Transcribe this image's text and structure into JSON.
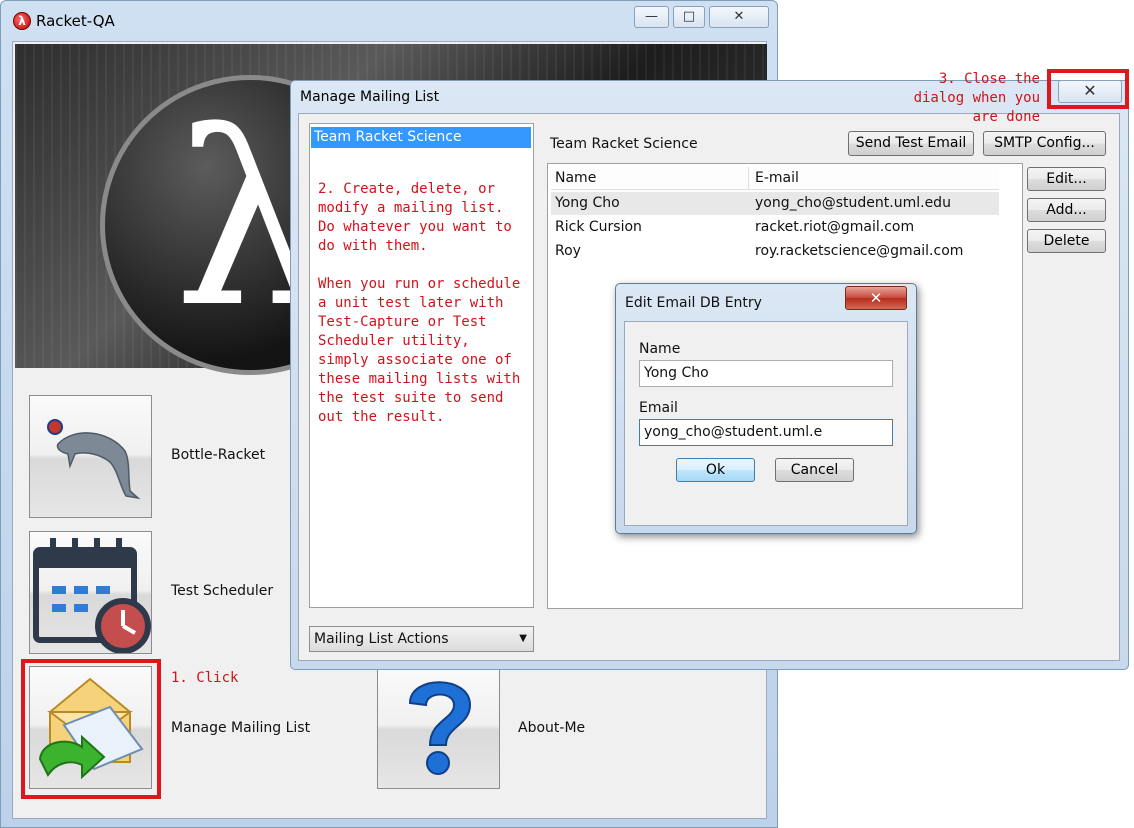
{
  "main_window": {
    "title": "Racket-QA",
    "logo_glyph": "λ",
    "minimize_glyph": "—",
    "maximize_glyph": "□",
    "close_glyph": "✕",
    "banner_glyph": "λ",
    "tiles": [
      {
        "label": "Bottle-Racket",
        "icon": "dolphin-icon"
      },
      {
        "label": "Test Scheduler",
        "icon": "calendar-clock-icon"
      },
      {
        "label": "Manage Mailing List",
        "icon": "mail-icon"
      },
      {
        "label": "About-Me",
        "icon": "question-icon"
      }
    ]
  },
  "annotations": {
    "step1": "1. Click",
    "step2": "2. Create, delete, or modify a mailing list. Do whatever you want to do with them.",
    "step2b": "When you run or schedule a unit test later with Test-Capture or Test Scheduler utility, simply associate one of these mailing lists with the test suite to send out the result.",
    "step3": "3. Close the dialog when you are done",
    "accent": "#e0151d"
  },
  "mailing_dialog": {
    "title": "Manage Mailing List",
    "close_glyph": "✕",
    "lists": [
      "Team Racket Science"
    ],
    "selected_list": "Team Racket Science",
    "send_test_label": "Send Test Email",
    "smtp_label": "SMTP Config...",
    "columns": [
      "Name",
      "E-mail"
    ],
    "rows": [
      {
        "name": "Yong Cho",
        "email": "yong_cho@student.uml.edu"
      },
      {
        "name": "Rick Cursion",
        "email": "racket.riot@gmail.com"
      },
      {
        "name": "Roy",
        "email": "roy.racketscience@gmail.com"
      }
    ],
    "edit_label": "Edit...",
    "add_label": "Add...",
    "delete_label": "Delete",
    "actions_label": "Mailing List Actions",
    "dropdown_glyph": "▼"
  },
  "edit_dialog": {
    "title": "Edit Email DB Entry",
    "close_glyph": "✕",
    "name_label": "Name",
    "name_value": "Yong Cho",
    "email_label": "Email",
    "email_value": "yong_cho@student.uml.e",
    "ok_label": "Ok",
    "cancel_label": "Cancel"
  }
}
